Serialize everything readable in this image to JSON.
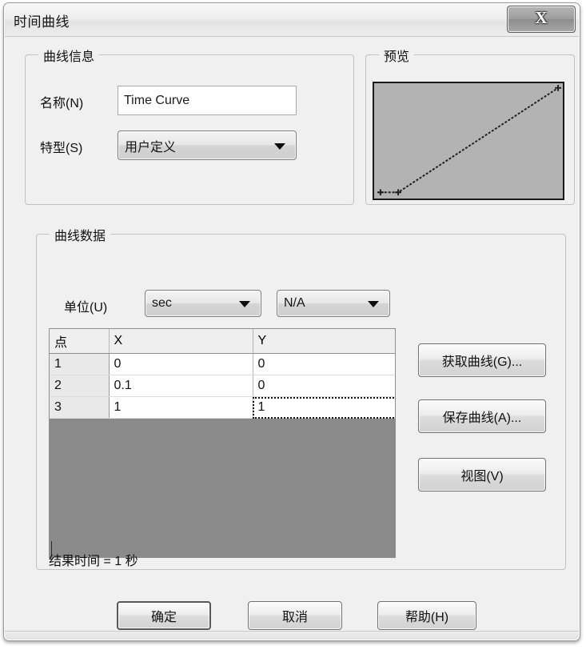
{
  "window": {
    "title": "时间曲线",
    "close_label": "X",
    "close_icon": "close-x-icon"
  },
  "curve_info": {
    "legend": "曲线信息",
    "name_label": "名称(N)",
    "name_value": "Time Curve",
    "name_placeholder": "",
    "type_label": "特型(S)",
    "type_value": "用户定义",
    "type_options": [
      "用户定义"
    ],
    "dropdown_icon": "chevron-down-icon"
  },
  "preview": {
    "legend": "预览",
    "background_color": "#b3b3b3",
    "line_color": "#1f1f1f"
  },
  "curve_data": {
    "legend": "曲线数据",
    "unit_label": "单位(U)",
    "unit_value": "sec",
    "unit_options": [
      "sec"
    ],
    "unit2_value": "N/A",
    "unit2_options": [
      "N/A"
    ],
    "table": {
      "headers": [
        "点",
        "X",
        "Y"
      ],
      "rows": [
        {
          "index": "1",
          "x": "0",
          "y": "0"
        },
        {
          "index": "2",
          "x": "0.1",
          "y": "0"
        },
        {
          "index": "3",
          "x": "1",
          "y": "1"
        }
      ],
      "focused_cell": {
        "row": 2,
        "column": "y"
      },
      "empty_area_color": "#8a8a8a"
    },
    "result_text": "结果时间 = 1 秒",
    "buttons": {
      "get_curve": "获取曲线(G)...",
      "save_curve": "保存曲线(A)...",
      "view": "视图(V)"
    }
  },
  "footer": {
    "ok": "确定",
    "cancel": "取消",
    "help": "帮助(H)"
  },
  "chart_data": {
    "type": "line",
    "title": "",
    "xlabel": "",
    "ylabel": "",
    "x": [
      0,
      0.1,
      1
    ],
    "values": [
      0,
      0,
      1
    ],
    "xlim": [
      0,
      1
    ],
    "ylim": [
      0,
      1
    ],
    "grid": false,
    "legend": "none",
    "series": [
      {
        "name": "Time Curve",
        "values": [
          0,
          0,
          1
        ]
      }
    ]
  }
}
